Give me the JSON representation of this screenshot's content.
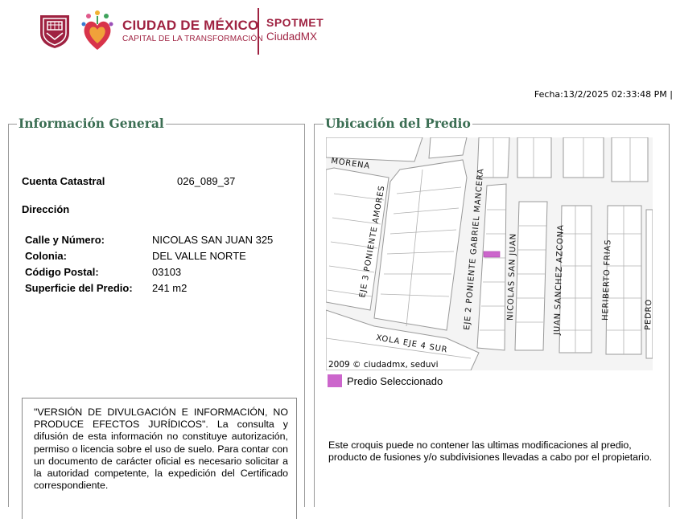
{
  "header": {
    "brand_title": "CIUDAD DE MÉXICO",
    "brand_subtitle": "CAPITAL DE LA TRANSFORMACIÓN",
    "app_title": "SPOTMET",
    "app_subtitle": "CiudadMX",
    "colors": {
      "brand": "#9f2241",
      "section_title": "#3b6e53",
      "selected_lot": "#cc66cc"
    }
  },
  "fecha": "Fecha:13/2/2025 02:33:48 PM |",
  "info": {
    "legend": "Información General",
    "cuenta_label": "Cuenta Catastral",
    "cuenta_value": "026_089_37",
    "direccion_label": "Dirección",
    "rows": [
      {
        "label": "Calle y Número:",
        "value": "NICOLAS SAN JUAN 325"
      },
      {
        "label": "Colonia:",
        "value": "DEL VALLE NORTE"
      },
      {
        "label": "Código Postal:",
        "value": "03103"
      },
      {
        "label": "Superficie del Predio:",
        "value": "241 m2"
      }
    ],
    "disclaimer": "\"VERSIÓN DE DIVULGACIÓN E INFORMACIÓN, NO PRODUCE EFECTOS JURÍDICOS\". La consulta y difusión de esta información no constituye autorización, permiso o licencia sobre el uso de suelo. Para contar con un documento de carácter oficial es necesario solicitar a la autoridad competente, la expedición del Certificado correspondiente."
  },
  "ubicacion": {
    "legend": "Ubicación del Predio",
    "streets": {
      "morena": "MORENA",
      "eje3": "EJE 3 PONIENTE AMORES",
      "eje2": "EJE 2 PONIENTE GABRIEL MANCERA",
      "nicolas": "NICOLAS SAN JUAN",
      "juan": "JUAN SANCHEZ AZCONA",
      "heriberto": "HERIBERTO FRIAS",
      "xola": "XOLA EJE 4 SUR",
      "edge": "PEDRO"
    },
    "copyright": "2009 © ciudadmx, seduvi",
    "legend_item": "Predio Seleccionado",
    "nota": "Este croquis puede no contener las ultimas modificaciones al predio, producto de fusiones y/o subdivisiones llevadas a cabo por el propietario."
  }
}
